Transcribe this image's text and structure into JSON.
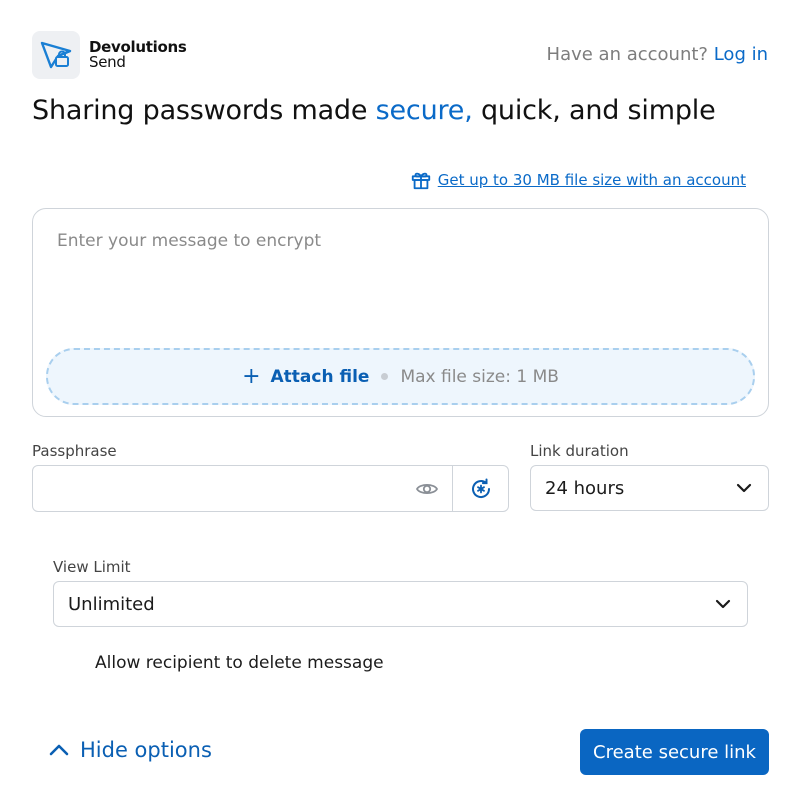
{
  "brand": {
    "name": "Devolutions",
    "product": "Send"
  },
  "header": {
    "account_prompt": "Have an account?",
    "login_label": "Log in"
  },
  "headline": {
    "before": "Sharing passwords made ",
    "accent": "secure,",
    "after": " quick, and simple"
  },
  "promo": {
    "text": "Get up to 30 MB file size with an account",
    "icon": "gift-icon"
  },
  "message": {
    "placeholder": "Enter your message to encrypt",
    "value": "",
    "attach_label": "Attach file",
    "max_size": "Max file size: 1 MB"
  },
  "passphrase": {
    "label": "Passphrase",
    "value": "",
    "show_icon": "eye-icon",
    "generate_icon": "password-generator-icon"
  },
  "link_duration": {
    "label": "Link duration",
    "selected": "24 hours"
  },
  "view_limit": {
    "label": "View Limit",
    "selected": "Unlimited"
  },
  "allow_delete": {
    "label": "Allow recipient to delete message"
  },
  "footer": {
    "hide_options_label": "Hide options",
    "create_label": "Create secure link"
  },
  "colors": {
    "accent": "#0a6ac8",
    "primary_button": "#0a66c2",
    "attach_bg": "#eef6fd",
    "border": "#cfd4da"
  }
}
